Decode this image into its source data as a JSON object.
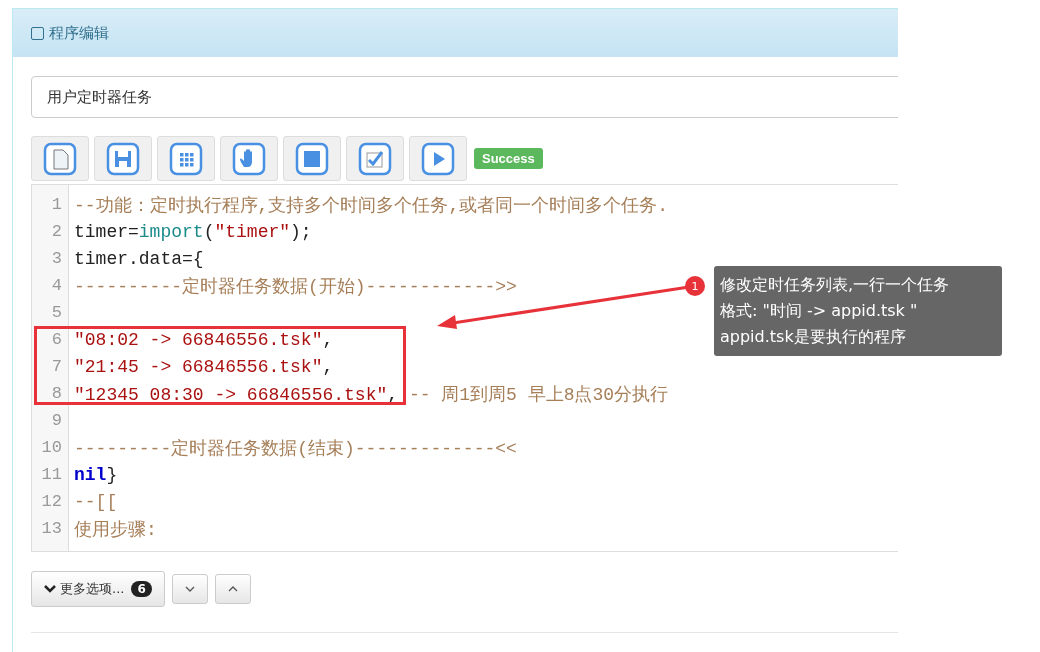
{
  "panel": {
    "title": "程序编辑"
  },
  "name_field": {
    "value": "用户定时器任务"
  },
  "toolbar": {
    "buttons": [
      {
        "kind": "new"
      },
      {
        "kind": "save"
      },
      {
        "kind": "grid"
      },
      {
        "kind": "hand"
      },
      {
        "kind": "stop"
      },
      {
        "kind": "check"
      },
      {
        "kind": "play"
      }
    ],
    "status": "Success"
  },
  "editor": {
    "lines": [
      {
        "number": "1",
        "highlighted": false,
        "tokens": [
          {
            "kind": "comment",
            "text": "--功能：定时执行程序,支持多个时间多个任务,或者同一个时间多个任务."
          }
        ]
      },
      {
        "number": "2",
        "highlighted": false,
        "tokens": [
          {
            "kind": "plain",
            "text": "timer="
          },
          {
            "kind": "builtin",
            "text": "import"
          },
          {
            "kind": "plain",
            "text": "("
          },
          {
            "kind": "string",
            "text": "\"timer\""
          },
          {
            "kind": "plain",
            "text": ");"
          }
        ]
      },
      {
        "number": "3",
        "highlighted": false,
        "tokens": [
          {
            "kind": "plain",
            "text": "timer.data={"
          }
        ]
      },
      {
        "number": "4",
        "highlighted": false,
        "tokens": [
          {
            "kind": "comment",
            "text": "----------定时器任务数据(开始)------------>>"
          }
        ]
      },
      {
        "number": "5",
        "highlighted": false
      },
      {
        "number": "6",
        "highlighted": true,
        "tokens": [
          {
            "kind": "string",
            "text": "\"08:02 -> 66846556.tsk\""
          },
          {
            "kind": "plain",
            "text": ","
          }
        ]
      },
      {
        "number": "7",
        "highlighted": true,
        "tokens": [
          {
            "kind": "string",
            "text": "\"21:45 -> 66846556.tsk\""
          },
          {
            "kind": "plain",
            "text": ","
          }
        ]
      },
      {
        "number": "8",
        "highlighted": true,
        "tokens": [
          {
            "kind": "string",
            "text": "\"12345 08:30 -> 66846556.tsk\""
          },
          {
            "kind": "plain",
            "text": ","
          },
          {
            "kind": "comment",
            "text": " -- 周1到周5 早上8点30分执行"
          }
        ]
      },
      {
        "number": "9",
        "highlighted": false
      },
      {
        "number": "10",
        "highlighted": false,
        "tokens": [
          {
            "kind": "comment",
            "text": "---------定时器任务数据(结束)-------------<<"
          }
        ]
      },
      {
        "number": "11",
        "highlighted": false,
        "tokens": [
          {
            "kind": "keyword",
            "text": "nil"
          },
          {
            "kind": "plain",
            "text": "}"
          }
        ]
      },
      {
        "number": "12",
        "highlighted": false,
        "tokens": [
          {
            "kind": "comment",
            "text": "--[["
          }
        ]
      },
      {
        "number": "13",
        "highlighted": false,
        "tokens": [
          {
            "kind": "comment",
            "text": "使用步骤:"
          }
        ]
      }
    ]
  },
  "footer": {
    "more_button": {
      "label": "更多选项...",
      "badge": "6"
    },
    "buttons": [
      {
        "kind": "down"
      },
      {
        "kind": "up"
      }
    ]
  },
  "callout": {
    "marker": "1",
    "lines": [
      "修改定时任务列表,一行一个任务",
      "格式: \"时间 -> appid.tsk \"",
      "appid.tsk是要执行的程序"
    ]
  }
}
